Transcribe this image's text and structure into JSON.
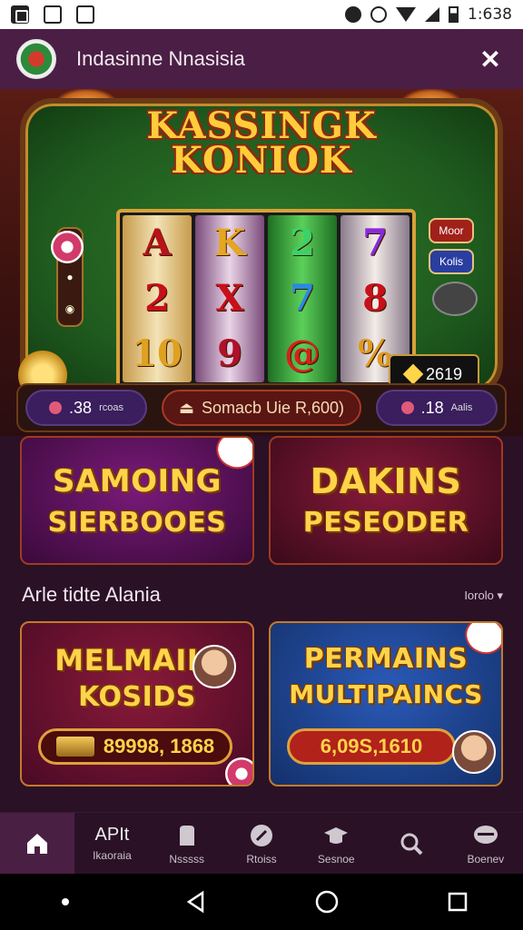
{
  "status_bar": {
    "time": "1:638"
  },
  "header": {
    "title": "Indasinne Nnasisia",
    "close_icon": "close-icon"
  },
  "hero": {
    "title_line1": "KASSINGK",
    "title_line2": "KONIOK",
    "reels": [
      [
        "A",
        "2",
        "10"
      ],
      [
        "K",
        "X",
        "9"
      ],
      [
        "2",
        "7",
        "@"
      ],
      [
        "7",
        "8",
        "%"
      ]
    ],
    "side_buttons": [
      "Moor",
      "Kolis"
    ],
    "jackpot": "2619",
    "controls": {
      "left": {
        "value": ".38",
        "label": "rcoas"
      },
      "center": "Somacb Uie R,600)",
      "right": {
        "value": ".18",
        "label": "Aalis"
      }
    }
  },
  "promos_top": [
    {
      "line1": "SAMOING",
      "line2": "SIERBOOES"
    },
    {
      "line1": "DAKINS",
      "line2": "PESEODER"
    }
  ],
  "section": {
    "title": "Arle tidte Alania",
    "link": "Iorolo"
  },
  "promos_bottom": [
    {
      "line1": "MELMAIIS",
      "line2": "KOSIDS",
      "amount": "89998, 1868"
    },
    {
      "line1": "PERMAINS",
      "line2": "MULTIPAINCS",
      "amount": "6,09S,1610"
    }
  ],
  "bottom_nav": [
    {
      "icon": "home-icon",
      "text": "",
      "label": ""
    },
    {
      "icon": "",
      "text": "APIt",
      "label": "Ikaoraia"
    },
    {
      "icon": "card-icon",
      "text": "",
      "label": "Nsssss"
    },
    {
      "icon": "compass-icon",
      "text": "",
      "label": "Rtoiss"
    },
    {
      "icon": "hat-icon",
      "text": "",
      "label": "Sesnoe"
    },
    {
      "icon": "search-icon",
      "text": "",
      "label": ""
    },
    {
      "icon": "chat-icon",
      "text": "",
      "label": "Boenev"
    }
  ],
  "colors": {
    "header_bg": "#4b1f45",
    "page_bg": "#2a1126",
    "gold": "#ffd34a"
  }
}
